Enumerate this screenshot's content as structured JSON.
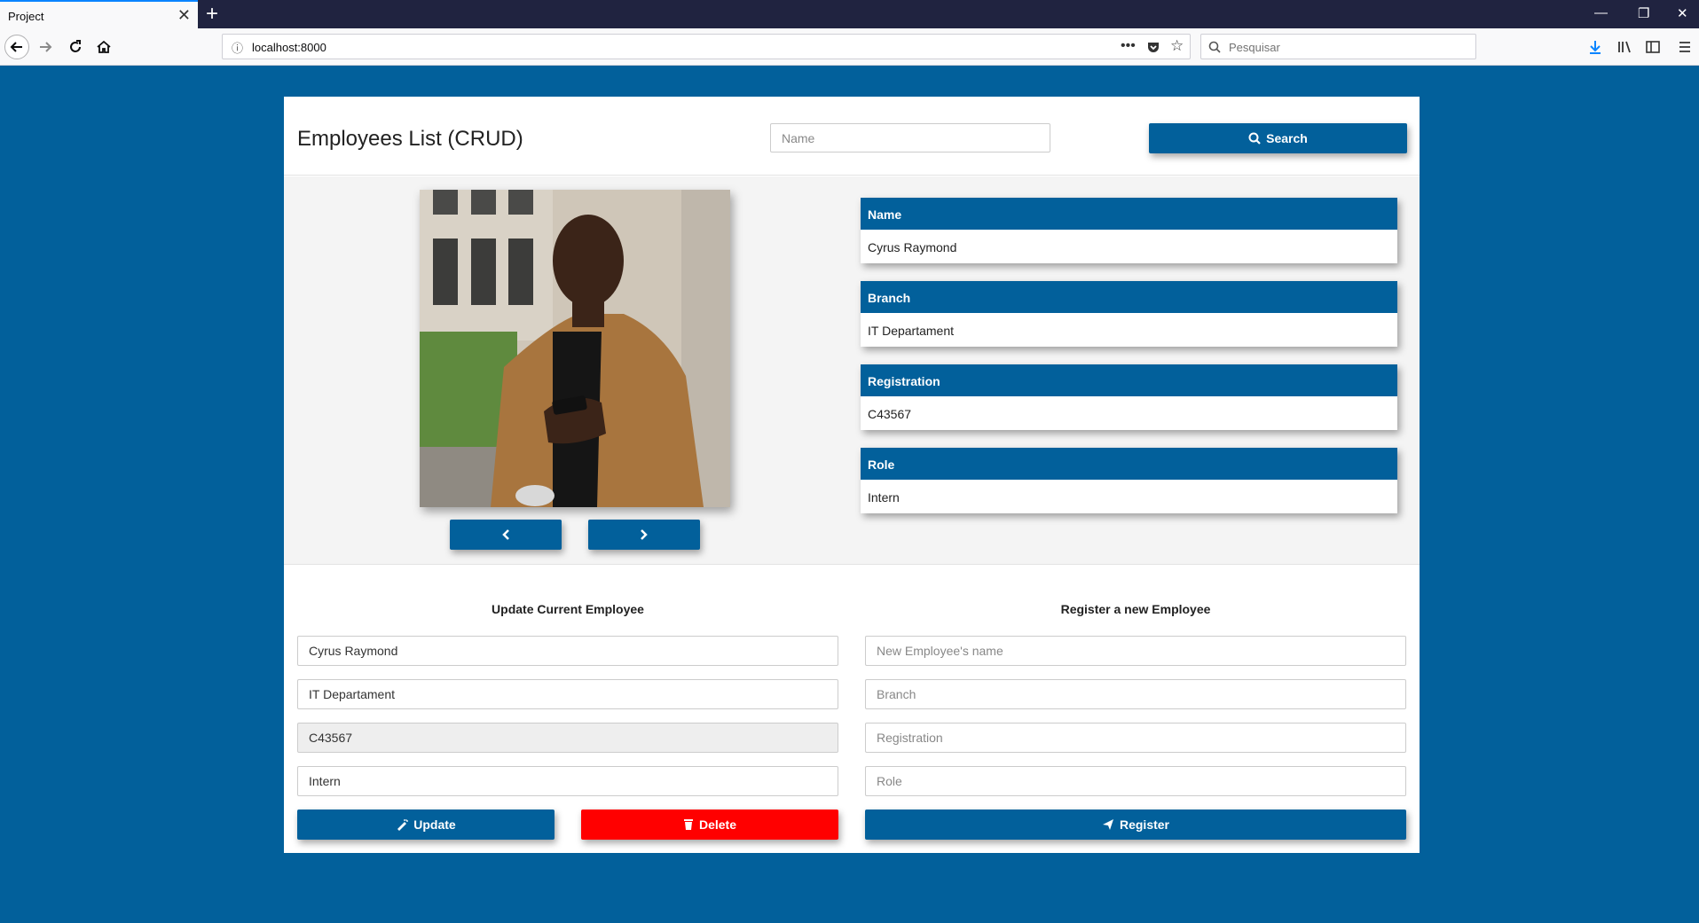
{
  "browser": {
    "tab_title": "Project",
    "url": "localhost:8000",
    "search_placeholder": "Pesquisar"
  },
  "header": {
    "title": "Employees List (CRUD)",
    "search_placeholder": "Name",
    "search_button": "Search"
  },
  "employee": {
    "name_label": "Name",
    "name": "Cyrus Raymond",
    "branch_label": "Branch",
    "branch": "IT Departament",
    "registration_label": "Registration",
    "registration": "C43567",
    "role_label": "Role",
    "role": "Intern"
  },
  "update_form": {
    "title": "Update Current Employee",
    "name": "Cyrus Raymond",
    "branch": "IT Departament",
    "registration": "C43567",
    "role": "Intern",
    "update_button": "Update",
    "delete_button": "Delete"
  },
  "register_form": {
    "title": "Register a new Employee",
    "name_placeholder": "New Employee's name",
    "branch_placeholder": "Branch",
    "registration_placeholder": "Registration",
    "role_placeholder": "Role",
    "register_button": "Register"
  },
  "colors": {
    "primary": "#02609b",
    "danger": "#ff0000"
  }
}
